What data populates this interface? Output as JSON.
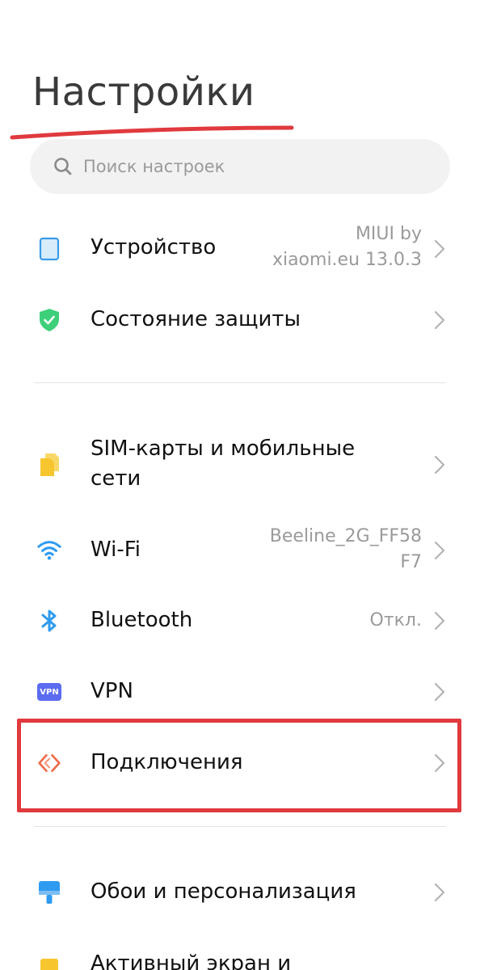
{
  "header": {
    "title": "Настройки"
  },
  "search": {
    "placeholder": "Поиск настроек"
  },
  "items": [
    {
      "label": "Устройство",
      "value_line1": "MIUI by",
      "value_line2": "xiaomi.eu 13.0.3",
      "icon": "phone-device-icon"
    },
    {
      "label": "Состояние защиты",
      "icon": "shield-check-icon"
    },
    {
      "label_line1": "SIM-карты и мобильные",
      "label_line2": "сети",
      "icon": "sim-cards-icon"
    },
    {
      "label": "Wi-Fi",
      "value_line1": "Beeline_2G_FF58",
      "value_line2": "F7",
      "icon": "wifi-icon"
    },
    {
      "label": "Bluetooth",
      "value": "Откл.",
      "icon": "bluetooth-icon"
    },
    {
      "label": "VPN",
      "icon_text": "VPN",
      "icon": "vpn-icon"
    },
    {
      "label": "Подключения",
      "icon": "connections-icon"
    },
    {
      "label": "Обои и персонализация",
      "icon": "wallpaper-brush-icon"
    },
    {
      "label": "Активный экран и",
      "icon": "display-icon"
    }
  ],
  "colors": {
    "accent_red": "#e03a3e",
    "shield_green": "#3ecf7a",
    "sim_yellow": "#f7c52e",
    "wifi_blue": "#2f9bf0",
    "vpn_indigo": "#5b6cf0",
    "connections_orange": "#ef6b4a"
  }
}
